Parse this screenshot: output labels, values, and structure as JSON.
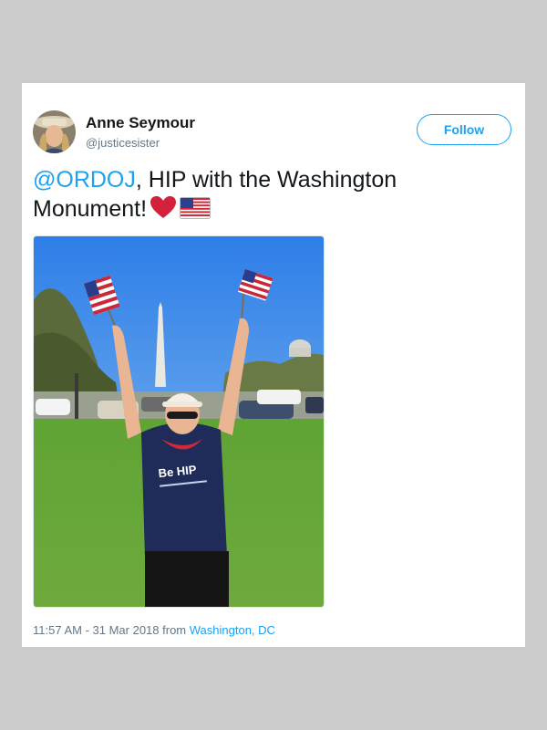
{
  "tweet": {
    "author": {
      "display_name": "Anne Seymour",
      "handle": "@justicesister"
    },
    "follow_label": "Follow",
    "text": {
      "mention": "@ORDOJ",
      "body": ", HIP with the Washington Monument!"
    },
    "emoji": [
      "red-heart-icon",
      "us-flag-icon"
    ],
    "timestamp": "11:57 AM - 31 Mar 2018",
    "from_label": "from",
    "location": "Washington, DC"
  },
  "photo": {
    "shirt_text": "Be HIP"
  },
  "colors": {
    "accent": "#1da1f2",
    "text": "#14171a",
    "secondary_text": "#657786",
    "background": "#cbcbcb",
    "card": "#ffffff"
  }
}
